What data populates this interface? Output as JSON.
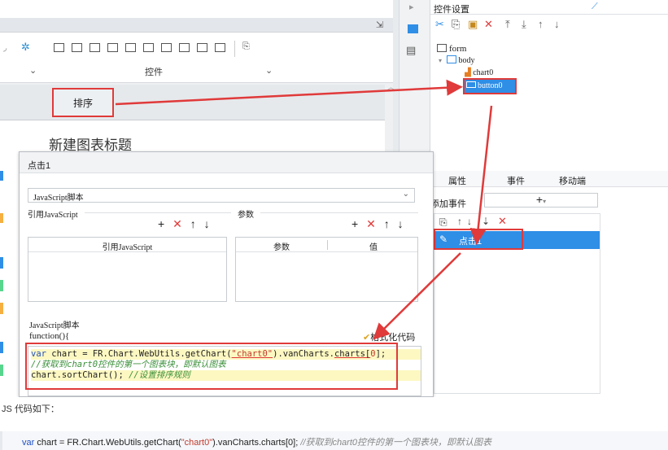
{
  "right_panel": {
    "title": "控件设置",
    "tree": {
      "form": "form",
      "body": "body",
      "chart": "chart0",
      "button": "button0"
    },
    "tabs": [
      "属性",
      "事件",
      "移动端"
    ],
    "add_event_label": "添加事件",
    "add_symbol": "+",
    "event_item": "点击1"
  },
  "toolbar": {
    "group_label": "控件",
    "chevron": "⌄"
  },
  "designer": {
    "sort_button_label": "排序",
    "chart_title": "新建图表标题"
  },
  "dialog": {
    "title": "点击1",
    "script_type": "JavaScript脚本",
    "ref_section_label": "引用JavaScript",
    "param_section_label": "参数",
    "ref_table_header": "引用JavaScript",
    "param_headers": [
      "参数",
      "值"
    ],
    "script_section_label": "JavaScript脚本",
    "function_header": "function(){",
    "format_button": "格式化代码",
    "code": {
      "line1_kw": "var",
      "line1_a": " chart = FR.Chart.WebUtils.getChart(",
      "line1_str": "\"chart0\"",
      "line1_b": ").vanCharts.",
      "line1_c": "charts[",
      "line1_num": "0",
      "line1_d": "];",
      "line2": "//获取到chart0控件的第一个图表块，即默认图表",
      "line3_a": "chart.sortChart(); ",
      "line3_cm": "//设置排序规则"
    }
  },
  "bottom": {
    "caption": "JS 代码如下：",
    "code_kw": "var",
    "code_a": " chart = FR.Chart.WebUtils.getChart(",
    "code_str": "\"chart0\"",
    "code_b": ").vanCharts.charts[0]; ",
    "code_cm": "//获取到chart0控件的第一个图表块，即默认图表"
  },
  "colors": {
    "accent_red": "#e03a3a",
    "selection_blue": "#2f8ee6",
    "highlight_yellow": "#fdf8c2"
  }
}
